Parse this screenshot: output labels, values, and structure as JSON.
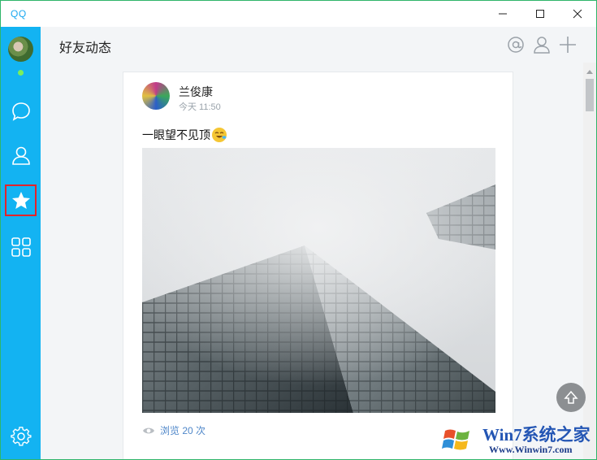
{
  "window": {
    "title": "QQ",
    "controls": [
      "minimize",
      "maximize",
      "close"
    ]
  },
  "sidebar": {
    "status": "online",
    "items": [
      {
        "id": "messages",
        "icon": "chat-bubble-icon"
      },
      {
        "id": "contacts",
        "icon": "person-icon"
      },
      {
        "id": "favorites",
        "icon": "star-icon",
        "active": true
      },
      {
        "id": "apps",
        "icon": "grid-icon"
      }
    ],
    "bottom_icon": "gear-icon"
  },
  "header": {
    "title": "好友动态",
    "actions": [
      "at-icon",
      "person-icon",
      "plus-icon"
    ]
  },
  "post": {
    "author": "兰俊康",
    "time": "今天 11:50",
    "text": "一眼望不见顶",
    "views": "浏览 20 次"
  },
  "watermark": {
    "title": "Win7系统之家",
    "url": "Www.Winwin7.com"
  },
  "colors": {
    "sidebar": "#13b3f2",
    "accent": "#1aa8f0",
    "selection_box": "#e4232a",
    "link": "#4f87c9"
  }
}
